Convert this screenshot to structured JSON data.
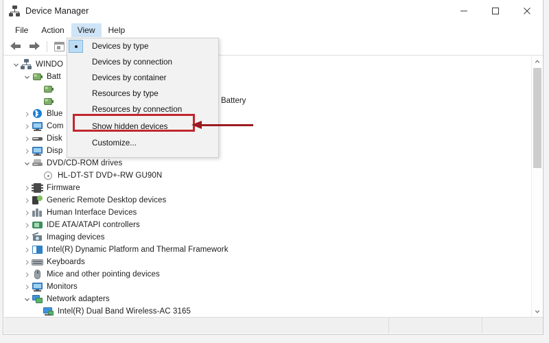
{
  "window": {
    "title": "Device Manager",
    "icon": "device-manager-icon",
    "controls": {
      "minimize": "minimize-icon",
      "maximize": "maximize-icon",
      "close": "close-icon"
    }
  },
  "menubar": {
    "items": [
      {
        "label": "File",
        "active": false
      },
      {
        "label": "Action",
        "active": false
      },
      {
        "label": "View",
        "active": true
      },
      {
        "label": "Help",
        "active": false
      }
    ]
  },
  "toolbar": {
    "buttons": [
      {
        "name": "back-button",
        "icon": "back-arrow-icon"
      },
      {
        "name": "forward-button",
        "icon": "forward-arrow-icon"
      },
      {
        "name": "properties-button",
        "icon": "properties-icon"
      }
    ]
  },
  "view_menu": {
    "open": true,
    "items": [
      {
        "label": "Devices by type",
        "selected": true,
        "highlighted": false
      },
      {
        "label": "Devices by connection",
        "selected": false,
        "highlighted": false
      },
      {
        "label": "Devices by container",
        "selected": false,
        "highlighted": false
      },
      {
        "label": "Resources by type",
        "selected": false,
        "highlighted": false
      },
      {
        "label": "Resources by connection",
        "selected": false,
        "highlighted": false
      },
      {
        "label": "Show hidden devices",
        "selected": false,
        "highlighted": true
      },
      {
        "label": "Customize...",
        "selected": false,
        "highlighted": false
      }
    ],
    "highlight_color": "#c1272d"
  },
  "annotation": {
    "type": "arrow",
    "direction": "left",
    "color": "#9b1a20",
    "points_at": "Show hidden devices"
  },
  "tree": {
    "occluded_text": "Battery",
    "rows": [
      {
        "label": "WINDO",
        "indent": 0,
        "twist": "expanded",
        "icon": "computer-node-icon",
        "truncated": true
      },
      {
        "label": "Batt",
        "indent": 1,
        "twist": "expanded",
        "icon": "battery-icon",
        "truncated": true
      },
      {
        "label": "",
        "indent": 2,
        "twist": "none",
        "icon": "battery-icon",
        "truncated": true
      },
      {
        "label": "",
        "indent": 2,
        "twist": "none",
        "icon": "battery-icon",
        "truncated": true
      },
      {
        "label": "Blue",
        "indent": 1,
        "twist": "collapsed",
        "icon": "bluetooth-icon",
        "truncated": true
      },
      {
        "label": "Com",
        "indent": 1,
        "twist": "collapsed",
        "icon": "computer-icon",
        "truncated": true
      },
      {
        "label": "Disk",
        "indent": 1,
        "twist": "collapsed",
        "icon": "disk-drive-icon",
        "truncated": true
      },
      {
        "label": "Disp",
        "indent": 1,
        "twist": "collapsed",
        "icon": "display-adapter-icon",
        "truncated": true
      },
      {
        "label": "DVD/CD-ROM drives",
        "indent": 1,
        "twist": "expanded",
        "icon": "dvd-drive-icon",
        "truncated": false
      },
      {
        "label": "HL-DT-ST DVD+-RW GU90N",
        "indent": 2,
        "twist": "none",
        "icon": "dvd-media-icon",
        "truncated": false
      },
      {
        "label": "Firmware",
        "indent": 1,
        "twist": "collapsed",
        "icon": "firmware-icon",
        "truncated": false
      },
      {
        "label": "Generic Remote Desktop devices",
        "indent": 1,
        "twist": "collapsed",
        "icon": "remote-desktop-icon",
        "truncated": false
      },
      {
        "label": "Human Interface Devices",
        "indent": 1,
        "twist": "collapsed",
        "icon": "hid-icon",
        "truncated": false
      },
      {
        "label": "IDE ATA/ATAPI controllers",
        "indent": 1,
        "twist": "collapsed",
        "icon": "ide-controller-icon",
        "truncated": false
      },
      {
        "label": "Imaging devices",
        "indent": 1,
        "twist": "collapsed",
        "icon": "imaging-device-icon",
        "truncated": false
      },
      {
        "label": "Intel(R) Dynamic Platform and Thermal Framework",
        "indent": 1,
        "twist": "collapsed",
        "icon": "intel-platform-icon",
        "truncated": false
      },
      {
        "label": "Keyboards",
        "indent": 1,
        "twist": "collapsed",
        "icon": "keyboard-icon",
        "truncated": false
      },
      {
        "label": "Mice and other pointing devices",
        "indent": 1,
        "twist": "collapsed",
        "icon": "mouse-icon",
        "truncated": false
      },
      {
        "label": "Monitors",
        "indent": 1,
        "twist": "collapsed",
        "icon": "monitor-icon",
        "truncated": false
      },
      {
        "label": "Network adapters",
        "indent": 1,
        "twist": "expanded",
        "icon": "network-adapter-icon",
        "truncated": false
      },
      {
        "label": "Intel(R) Dual Band Wireless-AC 3165",
        "indent": 2,
        "twist": "none",
        "icon": "network-card-icon",
        "truncated": false
      }
    ]
  },
  "scrollbar": {
    "up_arrow": "scroll-up-icon",
    "down_arrow": "scroll-down-icon",
    "thumb_position": "top"
  }
}
